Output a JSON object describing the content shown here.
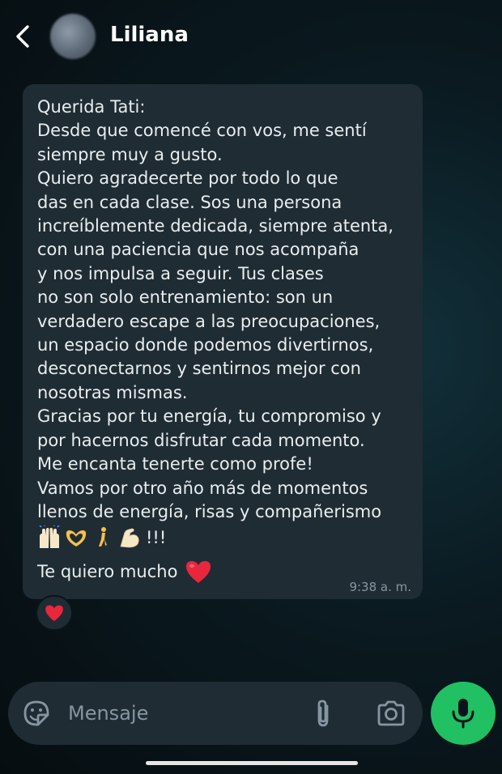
{
  "header": {
    "contact_name": "Liliana"
  },
  "message": {
    "text": "Querida Tati:\nDesde que comencé con vos, me sentí\nsiempre muy a gusto.\nQuiero agradecerte por todo lo que\ndas en cada clase. Sos una persona\nincreíblemente dedicada, siempre atenta,\ncon una paciencia que nos acompaña\ny nos impulsa a seguir. Tus clases\nno son solo entrenamiento: son un\nverdadero escape a las preocupaciones,\nun espacio donde podemos divertirnos,\ndesconectarnos y sentirnos mejor con\nnosotras mismas.\nGracias por tu energía, tu compromiso y\npor hacernos disfrutar cada momento.\nMe encanta tenerte como profe!\nVamos por otro año más de momentos\nllenos de energía, risas y compañerismo",
    "emoji_icons": [
      "raising-hands-icon",
      "heart-hands-icon",
      "dancer-icon",
      "flexed-biceps-icon"
    ],
    "emoji_suffix": "!!!",
    "closing": "Te quiero mucho",
    "closing_icon": "red-heart-icon",
    "time": "9:38 a. m.",
    "reaction_icon": "red-heart-icon"
  },
  "input": {
    "placeholder": "Mensaje"
  },
  "colors": {
    "bubble": "#1f2c34",
    "accent_green": "#21c063",
    "muted_text": "#8696a0",
    "heart_red": "#e8273d"
  }
}
